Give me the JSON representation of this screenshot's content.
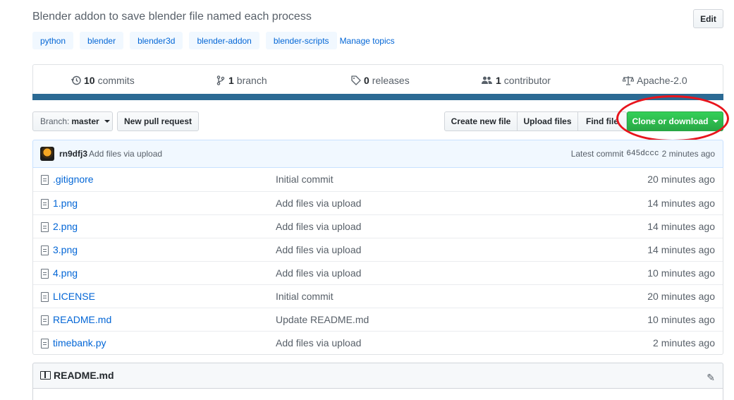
{
  "repo": {
    "description": "Blender addon to save blender file named each process",
    "edit_label": "Edit",
    "topics": [
      "python",
      "blender",
      "blender3d",
      "blender-addon",
      "blender-scripts"
    ],
    "manage_topics": "Manage topics"
  },
  "numbers": {
    "commits_count": "10",
    "commits_label": "commits",
    "branches_count": "1",
    "branches_label": "branch",
    "releases_count": "0",
    "releases_label": "releases",
    "contributors_count": "1",
    "contributors_label": "contributor",
    "license": "Apache-2.0"
  },
  "toolbar": {
    "branch_prefix": "Branch:",
    "branch_name": "master",
    "new_pull_request": "New pull request",
    "create_new_file": "Create new file",
    "upload_files": "Upload files",
    "find_file": "Find file",
    "clone_or_download": "Clone or download"
  },
  "commit": {
    "author": "rn9dfj3",
    "message": "Add files via upload",
    "latest_label": "Latest commit",
    "sha": "645dccc",
    "age": "2 minutes ago"
  },
  "files": [
    {
      "name": ".gitignore",
      "message": "Initial commit",
      "age": "20 minutes ago"
    },
    {
      "name": "1.png",
      "message": "Add files via upload",
      "age": "14 minutes ago"
    },
    {
      "name": "2.png",
      "message": "Add files via upload",
      "age": "14 minutes ago"
    },
    {
      "name": "3.png",
      "message": "Add files via upload",
      "age": "14 minutes ago"
    },
    {
      "name": "4.png",
      "message": "Add files via upload",
      "age": "10 minutes ago"
    },
    {
      "name": "LICENSE",
      "message": "Initial commit",
      "age": "20 minutes ago"
    },
    {
      "name": "README.md",
      "message": "Update README.md",
      "age": "10 minutes ago"
    },
    {
      "name": "timebank.py",
      "message": "Add files via upload",
      "age": "2 minutes ago"
    }
  ],
  "readme": {
    "title": "README.md"
  },
  "colors": {
    "accent_blue": "#0366d6",
    "clone_green": "#28a745",
    "annotation_red": "#e8141c",
    "language_bar": "#2b6a94"
  }
}
